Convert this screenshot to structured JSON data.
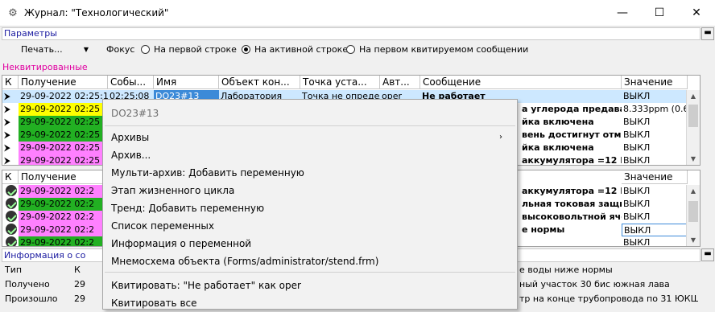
{
  "window": {
    "title": "Журнал: \"Технологический\"",
    "minimize": "—",
    "maximize": "☐",
    "close": "✕"
  },
  "params": {
    "label": "Параметры",
    "print_label": "Печать...",
    "focus_label": "Фокус",
    "options": [
      "На первой строке",
      "На активной строке",
      "На первом квитируемом сообщении"
    ],
    "selected_index": 1
  },
  "unack": {
    "label": "Неквитированные",
    "label_color": "#e000a0",
    "headers": [
      "К",
      "Получение",
      "Собы...",
      "Имя",
      "Объект кон...",
      "Точка уста...",
      "Авт...",
      "Сообщение",
      "Значение"
    ],
    "selected_row": {
      "received": "29-09-2022 02:25:13",
      "event": "02:25:08",
      "name": "DO23#13",
      "object": "Лаборатория",
      "point": "Точка не определе",
      "author": "oper",
      "message": "Не работает",
      "value": "ВЫКЛ"
    },
    "rows": [
      {
        "received": "29-09-2022 02:25",
        "bg": "#ffff00",
        "message": "а углерода предавар",
        "value": "8.333ppm (0.667В)"
      },
      {
        "received": "29-09-2022 02:25",
        "bg": "#22b022",
        "message": "йка включена",
        "value": "ВЫКЛ"
      },
      {
        "received": "29-09-2022 02:25",
        "bg": "#22b022",
        "message": "вень достигнут отме",
        "value": "ВЫКЛ"
      },
      {
        "received": "29-09-2022 02:25",
        "bg": "#ff80ff",
        "message": "йка включена",
        "value": "ВЫКЛ"
      },
      {
        "received": "29-09-2022 02:25",
        "bg": "#ff80ff",
        "message": "аккумулятора =12 В",
        "value": "ВЫКЛ"
      }
    ]
  },
  "ack": {
    "headers": [
      "К",
      "Получение",
      "Значение"
    ],
    "rows": [
      {
        "received": "29-09-2022 02:2",
        "bg": "#ff80ff",
        "message": "аккумулятора =12 В",
        "value": "ВЫКЛ"
      },
      {
        "received": "29-09-2022 02:2",
        "bg": "#22b022",
        "message": "льная токовая защит",
        "value": "ВЫКЛ"
      },
      {
        "received": "29-09-2022 02:2",
        "bg": "#ff80ff",
        "message": "высоковольтной ячей",
        "value": "ВЫКЛ"
      },
      {
        "received": "29-09-2022 02:2",
        "bg": "#ff80ff",
        "message": "е нормы",
        "value": "ВЫКЛ"
      },
      {
        "received": "29-09-2022 02:2",
        "bg": "#22b022",
        "message": "",
        "value": "ВЫКЛ"
      }
    ]
  },
  "info": {
    "label": "Информация о со",
    "rows": [
      {
        "key": "Тип",
        "val": "К",
        "tail": "е воды ниже нормы"
      },
      {
        "key": "Получено",
        "val": "29",
        "tail": "ный участок 30 бис южная лава"
      },
      {
        "key": "Произошло",
        "val": "29",
        "tail": "тр на конце трубопровода по 31 ЮКШ (31 Ю.Л.)"
      }
    ]
  },
  "context_menu": {
    "header": "DO23#13",
    "items": [
      {
        "label": "Архивы",
        "submenu": true
      },
      {
        "label": "Архив..."
      },
      {
        "label": "Мульти-архив: Добавить переменную"
      },
      {
        "label": "Этап жизненного цикла"
      },
      {
        "label": "Тренд: Добавить переменную"
      },
      {
        "label": "Список переменных"
      },
      {
        "label": "Информация о переменной"
      },
      {
        "label": "Мнемосхема объекта (Forms/administrator/stend.frm)"
      },
      {
        "label": "Квитировать: \"Не работает\" как oper"
      },
      {
        "label": "Квитировать все"
      }
    ]
  }
}
